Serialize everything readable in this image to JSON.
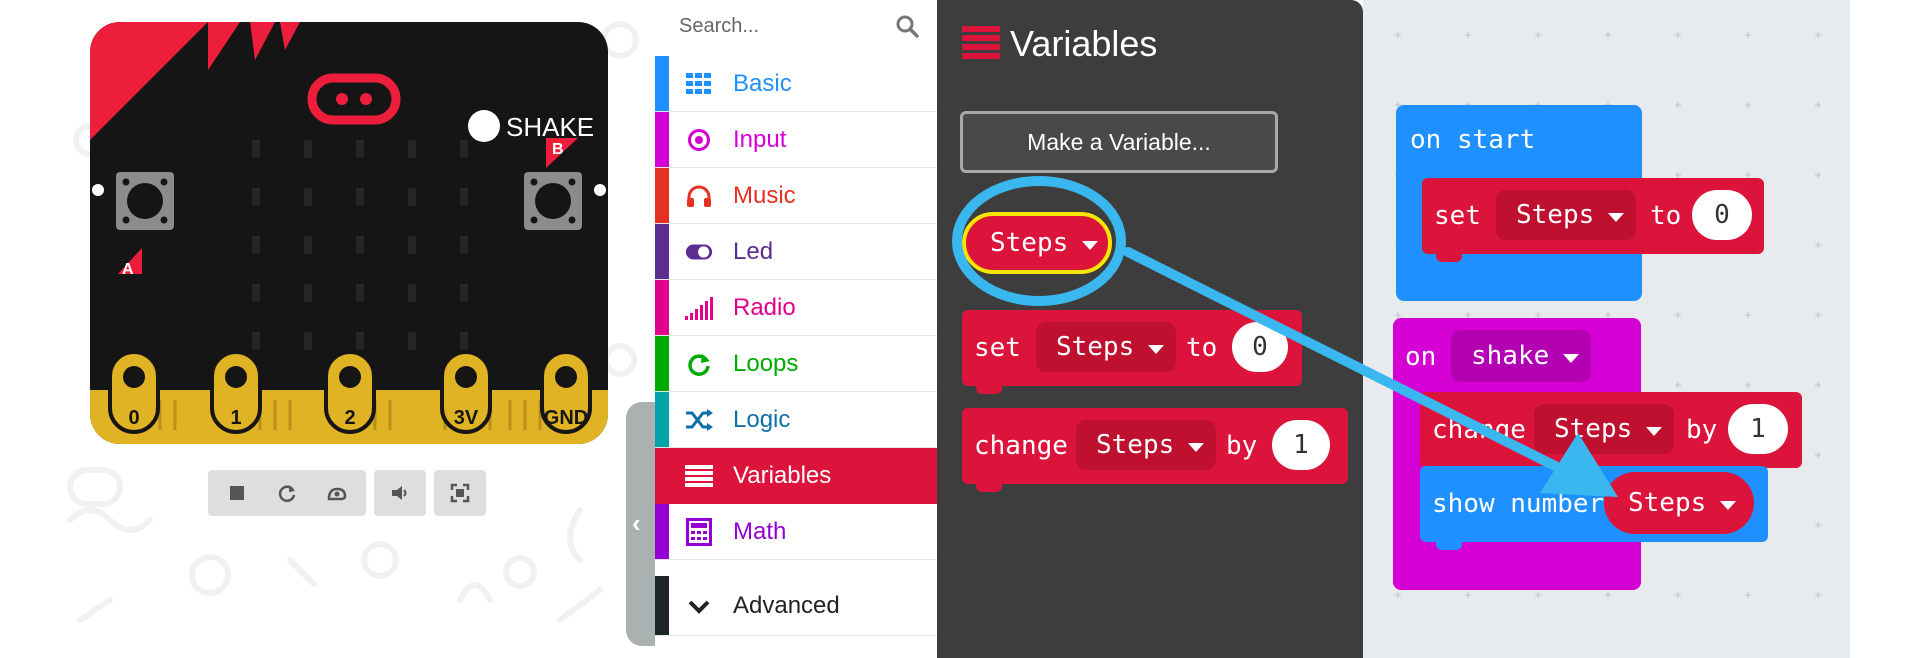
{
  "simulator": {
    "shake_label": "SHAKE",
    "button_a_label": "A",
    "button_b_label": "B",
    "pins": [
      "0",
      "1",
      "2",
      "3V",
      "GND"
    ],
    "controls": [
      {
        "name": "stop-icon"
      },
      {
        "name": "restart-icon"
      },
      {
        "name": "slow-motion-icon"
      },
      {
        "name": "sound-icon"
      },
      {
        "name": "fullscreen-icon"
      }
    ]
  },
  "search": {
    "placeholder": "Search..."
  },
  "toolbox": {
    "categories": [
      {
        "label": "Basic",
        "color": "#1e90ff",
        "icon": "grid-icon"
      },
      {
        "label": "Input",
        "color": "#d400d4",
        "icon": "target-icon"
      },
      {
        "label": "Music",
        "color": "#e63022",
        "icon": "headphones-icon"
      },
      {
        "label": "Led",
        "color": "#5c2d91",
        "icon": "toggle-icon"
      },
      {
        "label": "Radio",
        "color": "#e3008c",
        "icon": "signal-bars-icon"
      },
      {
        "label": "Loops",
        "color": "#00aa00",
        "icon": "refresh-icon"
      },
      {
        "label": "Logic",
        "color": "#00a4a6",
        "icon": "shuffle-icon"
      },
      {
        "label": "Variables",
        "color": "#dc143c",
        "icon": "list-icon"
      },
      {
        "label": "Math",
        "color": "#9400d3",
        "icon": "calculator-icon"
      },
      {
        "label": "Advanced",
        "color": "#333333",
        "icon": "chevron-down-icon"
      }
    ],
    "selected": "Variables"
  },
  "flyout": {
    "title": "Variables",
    "make_variable": "Make a Variable...",
    "variable_name": "Steps",
    "set_block": {
      "keyword": "set",
      "var": "Steps",
      "to": "to",
      "value": "0"
    },
    "change_block": {
      "keyword": "change",
      "var": "Steps",
      "by": "by",
      "value": "1"
    }
  },
  "workspace": {
    "on_start": {
      "label": "on start",
      "set": {
        "keyword": "set",
        "var": "Steps",
        "to": "to",
        "value": "0"
      }
    },
    "on_shake": {
      "on": "on",
      "event": "shake",
      "change": {
        "keyword": "change",
        "var": "Steps",
        "by": "by",
        "value": "1"
      },
      "show": {
        "keyword": "show number",
        "var": "Steps"
      }
    }
  },
  "colors": {
    "variables_block": "#dc143c",
    "basic_block": "#1e90ff",
    "input_block": "#d400d4",
    "annotation": "#3ab7ee",
    "flyout_bg": "#3d3d3d",
    "workspace_bg": "#e8ebee"
  }
}
